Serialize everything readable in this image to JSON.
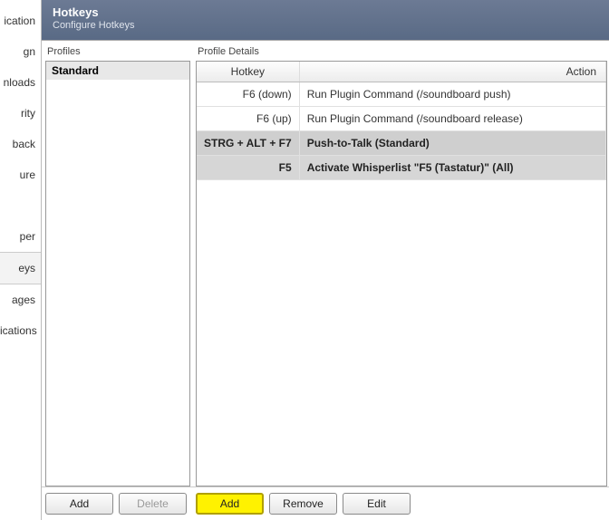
{
  "sidebar": {
    "items": [
      {
        "label": "ication"
      },
      {
        "label": "gn"
      },
      {
        "label": "nloads"
      },
      {
        "label": "rity"
      },
      {
        "label": "back"
      },
      {
        "label": "ure"
      },
      {
        "label": ""
      },
      {
        "label": "per"
      },
      {
        "label": "eys"
      },
      {
        "label": "ages"
      },
      {
        "label": "ications"
      }
    ],
    "selectedIndex": 8
  },
  "header": {
    "title": "Hotkeys",
    "subtitle": "Configure Hotkeys"
  },
  "profiles": {
    "label": "Profiles",
    "items": [
      "Standard"
    ],
    "selectedIndex": 0
  },
  "details": {
    "label": "Profile Details",
    "columns": {
      "hotkey": "Hotkey",
      "action": "Action"
    },
    "rows": [
      {
        "hotkey": "F6 (down)",
        "action": "Run Plugin Command (/soundboard push)",
        "selected": false
      },
      {
        "hotkey": "F6 (up)",
        "action": "Run Plugin Command (/soundboard release)",
        "selected": false
      },
      {
        "hotkey": "STRG + ALT + F7",
        "action": "Push-to-Talk (Standard)",
        "selected": true
      },
      {
        "hotkey": "F5",
        "action": "Activate Whisperlist \"F5 (Tastatur)\" (All)",
        "selected": true
      }
    ]
  },
  "buttons": {
    "profiles_add": "Add",
    "profiles_delete": "Delete",
    "details_add": "Add",
    "details_remove": "Remove",
    "details_edit": "Edit"
  }
}
